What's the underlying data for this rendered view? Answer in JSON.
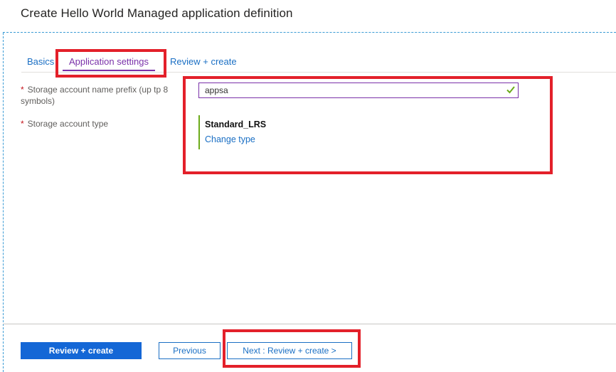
{
  "header": {
    "title": "Create Hello World Managed application definition"
  },
  "tabs": [
    {
      "label": "Basics",
      "active": false
    },
    {
      "label": "Application settings",
      "active": true
    },
    {
      "label": "Review + create",
      "active": false
    }
  ],
  "form": {
    "storage_prefix": {
      "required_mark": "*",
      "label": "Storage account name prefix (up tp 8 symbols)",
      "value": "appsa",
      "valid": true
    },
    "storage_type": {
      "required_mark": "*",
      "label": "Storage account type",
      "value": "Standard_LRS",
      "change_link": "Change type"
    }
  },
  "footer": {
    "primary_label": "Review + create",
    "previous_label": "Previous",
    "next_label": "Next : Review + create >"
  },
  "colors": {
    "accent_purple": "#7a31a9",
    "link_blue": "#1a6fc4",
    "primary_button": "#1467d6",
    "annotation_red": "#e3202a",
    "valid_green": "#6cab1a"
  },
  "icons": {
    "valid": "check-icon"
  }
}
